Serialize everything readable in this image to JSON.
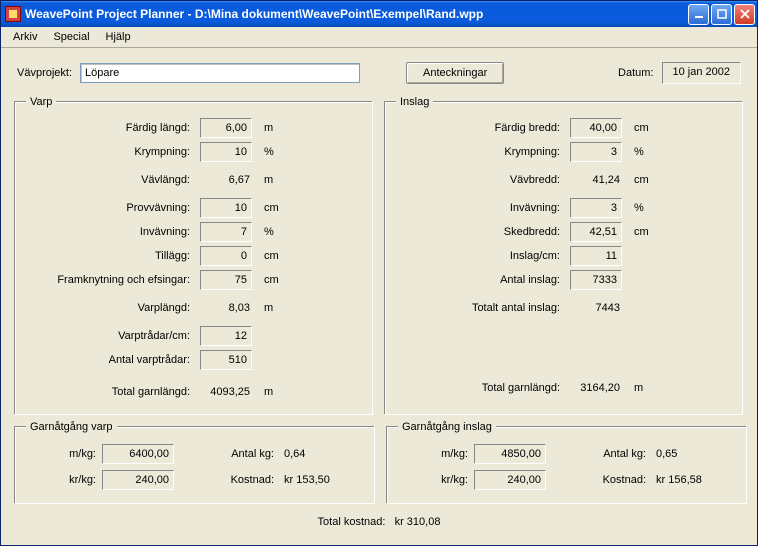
{
  "window": {
    "title": "WeavePoint Project Planner  - D:\\Mina dokument\\WeavePoint\\Exempel\\Rand.wpp"
  },
  "menu": {
    "arkiv": "Arkiv",
    "special": "Special",
    "hjalp": "Hjälp"
  },
  "top": {
    "project_label": "Vävprojekt:",
    "project_value": "Löpare",
    "notes_button": "Anteckningar",
    "date_label": "Datum:",
    "date_value": "10 jan 2002"
  },
  "varp": {
    "legend": "Varp",
    "fardig_langd": {
      "label": "Färdig längd:",
      "value": "6,00",
      "unit": "m"
    },
    "krympning": {
      "label": "Krympning:",
      "value": "10",
      "unit": "%"
    },
    "vavlangd": {
      "label": "Vävlängd:",
      "value": "6,67",
      "unit": "m"
    },
    "provvavning": {
      "label": "Provvävning:",
      "value": "10",
      "unit": "cm"
    },
    "invavning": {
      "label": "Invävning:",
      "value": "7",
      "unit": "%"
    },
    "tillagg": {
      "label": "Tillägg:",
      "value": "0",
      "unit": "cm"
    },
    "framknytning": {
      "label": "Framknytning och efsingar:",
      "value": "75",
      "unit": "cm"
    },
    "varplangd": {
      "label": "Varplängd:",
      "value": "8,03",
      "unit": "m"
    },
    "varptradar_cm": {
      "label": "Varptrådar/cm:",
      "value": "12"
    },
    "antal_varptr": {
      "label": "Antal varptrådar:",
      "value": "510"
    },
    "total_garn": {
      "label": "Total garnlängd:",
      "value": "4093,25",
      "unit": "m"
    }
  },
  "inslag": {
    "legend": "Inslag",
    "fardig_bredd": {
      "label": "Färdig bredd:",
      "value": "40,00",
      "unit": "cm"
    },
    "krympning": {
      "label": "Krympning:",
      "value": "3",
      "unit": "%"
    },
    "vavbredd": {
      "label": "Vävbredd:",
      "value": "41,24",
      "unit": "cm"
    },
    "invavning": {
      "label": "Invävning:",
      "value": "3",
      "unit": "%"
    },
    "skedbredd": {
      "label": "Skedbredd:",
      "value": "42,51",
      "unit": "cm"
    },
    "inslag_cm": {
      "label": "Inslag/cm:",
      "value": "11"
    },
    "antal_inslag": {
      "label": "Antal inslag:",
      "value": "7333"
    },
    "totalt_antal": {
      "label": "Totalt antal inslag:",
      "value": "7443"
    },
    "total_garn": {
      "label": "Total garnlängd:",
      "value": "3164,20",
      "unit": "m"
    }
  },
  "yarn_varp": {
    "legend": "Garnåtgång varp",
    "m_kg": {
      "label": "m/kg:",
      "value": "6400,00"
    },
    "kr_kg": {
      "label": "kr/kg:",
      "value": "240,00"
    },
    "antal_kg": {
      "label": "Antal kg:",
      "value": "0,64"
    },
    "kostnad": {
      "label": "Kostnad:",
      "value": "kr 153,50"
    }
  },
  "yarn_inslag": {
    "legend": "Garnåtgång inslag",
    "m_kg": {
      "label": "m/kg:",
      "value": "4850,00"
    },
    "kr_kg": {
      "label": "kr/kg:",
      "value": "240,00"
    },
    "antal_kg": {
      "label": "Antal kg:",
      "value": "0,65"
    },
    "kostnad": {
      "label": "Kostnad:",
      "value": "kr 156,58"
    }
  },
  "total_cost": {
    "label": "Total kostnad:",
    "value": "kr 310,08"
  }
}
